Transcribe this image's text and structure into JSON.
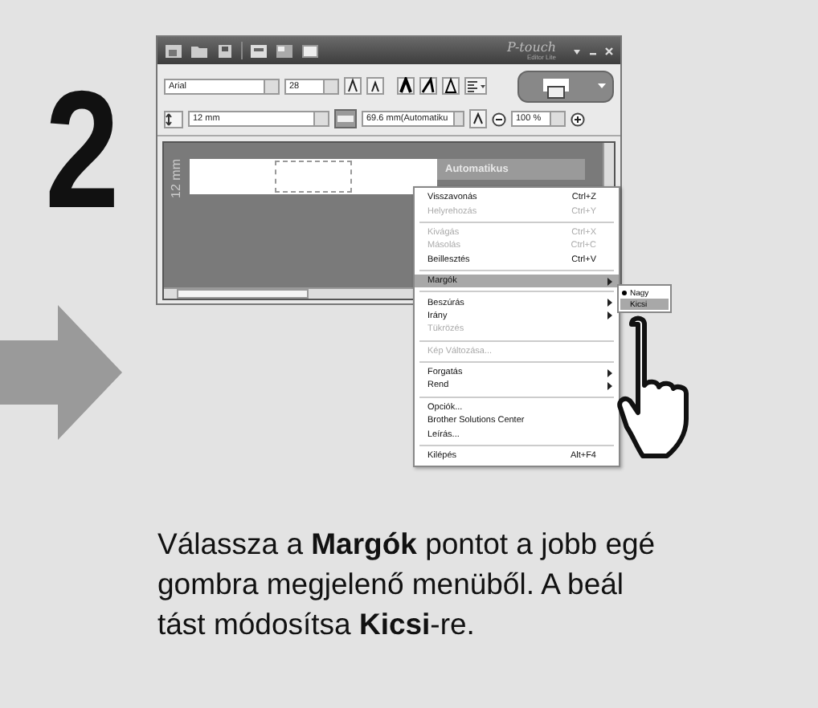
{
  "step_number": "2",
  "window": {
    "logo": "P-touch",
    "logo_sub": "Editor Lite",
    "toolbar": {
      "font": "Arial",
      "size": "28",
      "tape_width": "12 mm",
      "length": "69.6 mm(Automatiku",
      "zoom": "100 %"
    },
    "canvas": {
      "tape_label": "12 mm",
      "length_mode": "Automatikus"
    }
  },
  "context_menu": {
    "items": [
      {
        "kind": "item",
        "label": "Visszavonás",
        "shortcut": "Ctrl+Z",
        "disabled": false,
        "selected": false
      },
      {
        "kind": "item",
        "label": "Helyrehozás",
        "shortcut": "Ctrl+Y",
        "disabled": true,
        "selected": false
      },
      {
        "kind": "separator"
      },
      {
        "kind": "item",
        "label": "Kivágás",
        "shortcut": "Ctrl+X",
        "disabled": true,
        "selected": false
      },
      {
        "kind": "item",
        "label": "Másolás",
        "shortcut": "Ctrl+C",
        "disabled": true,
        "selected": false
      },
      {
        "kind": "item",
        "label": "Beillesztés",
        "shortcut": "Ctrl+V",
        "disabled": false,
        "selected": false
      },
      {
        "kind": "separator"
      },
      {
        "kind": "submenu",
        "label": "Margók",
        "disabled": false,
        "selected": true
      },
      {
        "kind": "separator"
      },
      {
        "kind": "submenu",
        "label": "Beszúrás",
        "disabled": false,
        "selected": false
      },
      {
        "kind": "submenu",
        "label": "Irány",
        "disabled": false,
        "selected": false
      },
      {
        "kind": "item",
        "label": "Tükrözés",
        "disabled": true,
        "selected": false
      },
      {
        "kind": "separator"
      },
      {
        "kind": "item",
        "label": "Kép Változása...",
        "disabled": true,
        "selected": false
      },
      {
        "kind": "separator"
      },
      {
        "kind": "submenu",
        "label": "Forgatás",
        "disabled": false,
        "selected": false
      },
      {
        "kind": "submenu",
        "label": "Rend",
        "disabled": false,
        "selected": false
      },
      {
        "kind": "separator"
      },
      {
        "kind": "item",
        "label": "Opciók...",
        "disabled": false,
        "selected": false
      },
      {
        "kind": "item",
        "label": "Brother Solutions Center",
        "disabled": false,
        "selected": false
      },
      {
        "kind": "item",
        "label": "Leírás...",
        "disabled": false,
        "selected": false
      },
      {
        "kind": "separator"
      },
      {
        "kind": "item",
        "label": "Kilépés",
        "shortcut": "Alt+F4",
        "disabled": false,
        "selected": false
      }
    ]
  },
  "submenu": {
    "items": [
      {
        "label": "Nagy",
        "checked": true,
        "selected": false
      },
      {
        "label": "Kicsi",
        "checked": false,
        "selected": true
      }
    ]
  },
  "instruction_lines": [
    "Válassza a **Margók** pontot a jobb egé",
    "gombra megjelenő menüből. A beál",
    "tást módosítsa **Kicsi**-re."
  ]
}
